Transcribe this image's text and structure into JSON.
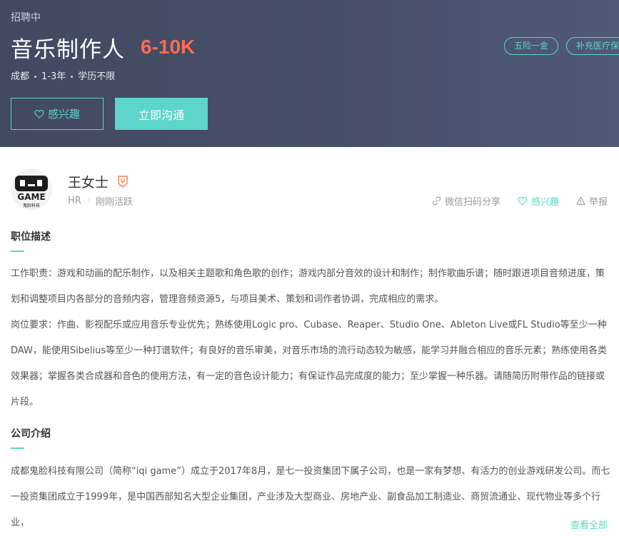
{
  "header": {
    "status": "招聘中",
    "job_title": "音乐制作人",
    "salary": "6-10K",
    "meta": [
      "成都",
      "1-3年",
      "学历不限"
    ],
    "tags": [
      "五险一金",
      "补充医疗保"
    ],
    "like_button": "感兴趣",
    "chat_button": "立即沟通",
    "accent_color": "#5dd5c8",
    "salary_color": "#fd6c51"
  },
  "recruiter": {
    "name": "王女士",
    "role": "HR",
    "activity": "刚刚活跃",
    "avatar_text": "iqi GAME",
    "avatar_subtext": "鬼脸科技",
    "actions": {
      "share": "微信扫码分享",
      "like": "感兴趣",
      "report": "举报"
    }
  },
  "job_description": {
    "title": "职位描述",
    "paragraphs": [
      "工作职责：游戏和动画的配乐制作，以及相关主题歌和角色歌的创作；游戏内部分音效的设计和制作；制作歌曲乐谱；随时跟进项目音频进度，策划和调整项目内各部分的音频内容，管理音频资源5，与项目美术、策划和词作者协调，完成相应的需求。",
      "岗位要求：作曲、影视配乐或应用音乐专业优先；熟练使用Logic pro、Cubase、Reaper、Studio One、Ableton Live或FL Studio等至少一种DAW，能使用Sibelius等至少一种打谱软件；有良好的音乐审美，对音乐市场的流行动态较为敏感，能学习并融合相应的音乐元素；熟练使用各类效果器；掌握各类合成器和音色的使用方法，有一定的音色设计能力；有保证作品完成度的能力；至少掌握一种乐器。请随简历附带作品的链接或片段。"
    ]
  },
  "company": {
    "title": "公司介绍",
    "text": "成都鬼脸科技有限公司（简称“iqi game”）成立于2017年8月，是七一投资集团下属子公司，也是一家有梦想、有活力的创业游戏研发公司。而七一投资集团成立于1999年，是中国西部知名大型企业集团，产业涉及大型商业、房地产业、副食品加工制造业、商贸流通业、现代物业等多个行业，",
    "more": "查看全部"
  }
}
